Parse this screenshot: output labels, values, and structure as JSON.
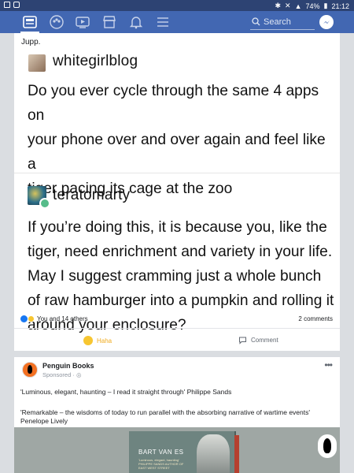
{
  "status_bar": {
    "battery": "74%",
    "time": "21:12"
  },
  "nav": {
    "search_placeholder": "Search"
  },
  "post1": {
    "caption": "Jupp.",
    "tumblr": [
      {
        "username": "whitegirlblog",
        "lines": [
          "Do you ever cycle through the same 4 apps on",
          "your phone over and over again and feel like a",
          "tiger pacing its cage at the zoo"
        ]
      },
      {
        "username": "teratomarty",
        "lines": [
          "If you’re doing this, it is because you, like the",
          "tiger, need enrichment and variety in your life.",
          "May I suggest cramming just a whole bunch",
          "of raw hamburger into a pumpkin and rolling it",
          "around your enclosure?"
        ]
      }
    ],
    "reactions_text": "You and 14 others",
    "comments_count": "2 comments",
    "actions": {
      "haha": "Haha",
      "comment": "Comment"
    }
  },
  "post2": {
    "page_name": "Penguin Books",
    "sponsored": "Sponsored ·",
    "text1": "'Luminous, elegant, haunting – I read it straight through' Philippe Sands",
    "text2": "'Remarkable – the wisdoms of today to run parallel with the absorbing narrative of wartime events' Penelope Lively",
    "book_author": "BART VAN ES",
    "book_blurb": "'Luminous, elegant, haunting' PHILIPPE SANDS AUTHOR OF EAST WEST STREET"
  }
}
